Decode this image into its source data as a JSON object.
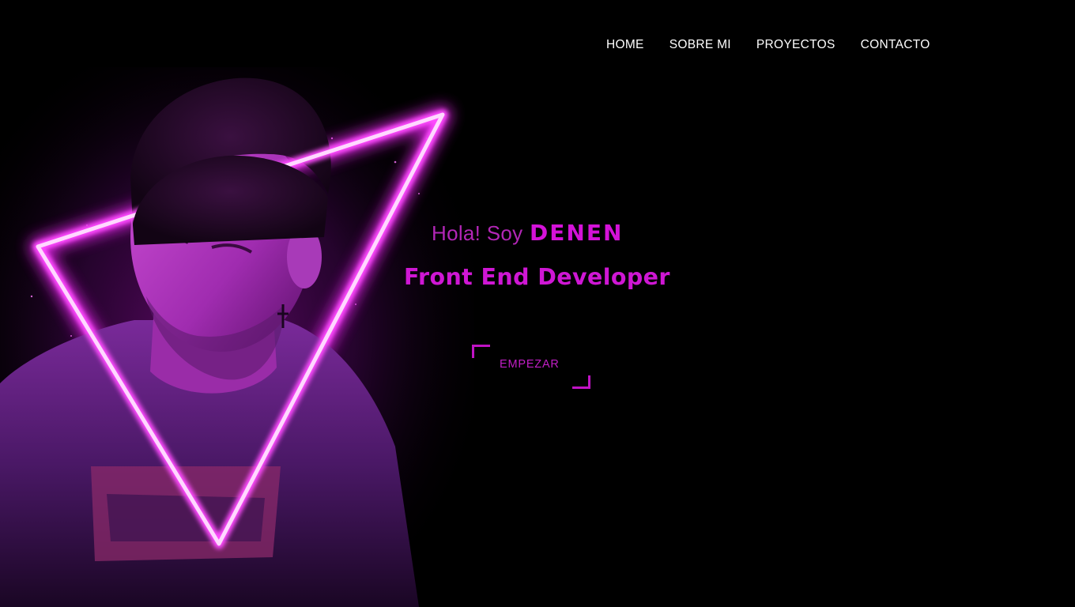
{
  "nav": {
    "items": [
      {
        "label": "HOME"
      },
      {
        "label": "SOBRE MI"
      },
      {
        "label": "PROYECTOS"
      },
      {
        "label": "CONTACTO"
      }
    ]
  },
  "hero": {
    "greeting_prefix": "Hola! Soy",
    "name": "DENEN",
    "role": "Front End Developer",
    "cta_label": "EMPEZAR",
    "image_description": "portrait-neon-triangle"
  },
  "colors": {
    "background": "#000000",
    "accent": "#d412d8",
    "nav_text": "#ffffff"
  }
}
